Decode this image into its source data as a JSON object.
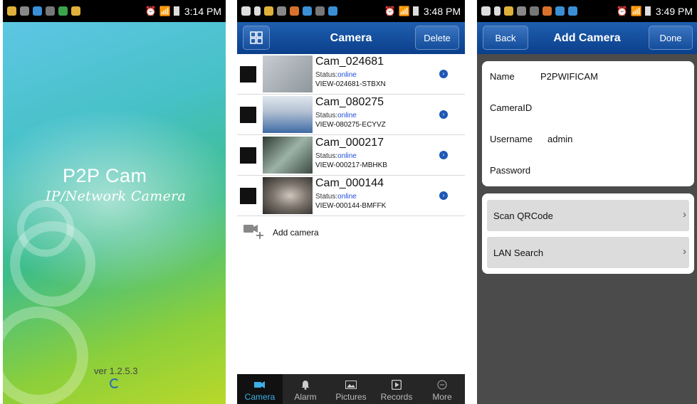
{
  "screen1": {
    "status": {
      "time": "3:14 PM"
    },
    "title": "P2P Cam",
    "subtitle": "IP/Network Camera",
    "version": "ver 1.2.5.3"
  },
  "screen2": {
    "status": {
      "time": "3:48 PM"
    },
    "header": {
      "title": "Camera",
      "delete_label": "Delete"
    },
    "cameras": [
      {
        "name": "Cam_024681",
        "status_label": "Status:",
        "status": "online",
        "uid": "VIEW-024681-STBXN",
        "thumb_color": "#9aa2a8"
      },
      {
        "name": "Cam_080275",
        "status_label": "Status:",
        "status": "online",
        "uid": "VIEW-080275-ECYVZ",
        "thumb_color": "#5c82b8"
      },
      {
        "name": "Cam_000217",
        "status_label": "Status:",
        "status": "online",
        "uid": "VIEW-000217-MBHKB",
        "thumb_color": "#5a7063"
      },
      {
        "name": "Cam_000144",
        "status_label": "Status:",
        "status": "online",
        "uid": "VIEW-000144-BMFFK",
        "thumb_color": "#6f6a64"
      }
    ],
    "add_camera": "Add camera",
    "tabs": [
      {
        "label": "Camera",
        "icon": "video-camera-icon",
        "active": true
      },
      {
        "label": "Alarm",
        "icon": "bell-icon",
        "active": false
      },
      {
        "label": "Pictures",
        "icon": "image-icon",
        "active": false
      },
      {
        "label": "Records",
        "icon": "play-icon",
        "active": false
      },
      {
        "label": "More",
        "icon": "more-icon",
        "active": false
      }
    ]
  },
  "screen3": {
    "status": {
      "time": "3:49 PM"
    },
    "header": {
      "title": "Add Camera",
      "back_label": "Back",
      "done_label": "Done"
    },
    "fields": {
      "name": {
        "label": "Name",
        "value": "P2PWIFICAM"
      },
      "camera_id": {
        "label": "CameraID",
        "value": ""
      },
      "username": {
        "label": "Username",
        "value": "admin"
      },
      "password": {
        "label": "Password",
        "value": ""
      }
    },
    "options": [
      {
        "label": "Scan QRCode"
      },
      {
        "label": "LAN Search"
      }
    ]
  },
  "colors": {
    "nav_blue": "#1a55a5",
    "online_blue": "#1d4fd8",
    "tab_active": "#3bb0e6"
  }
}
